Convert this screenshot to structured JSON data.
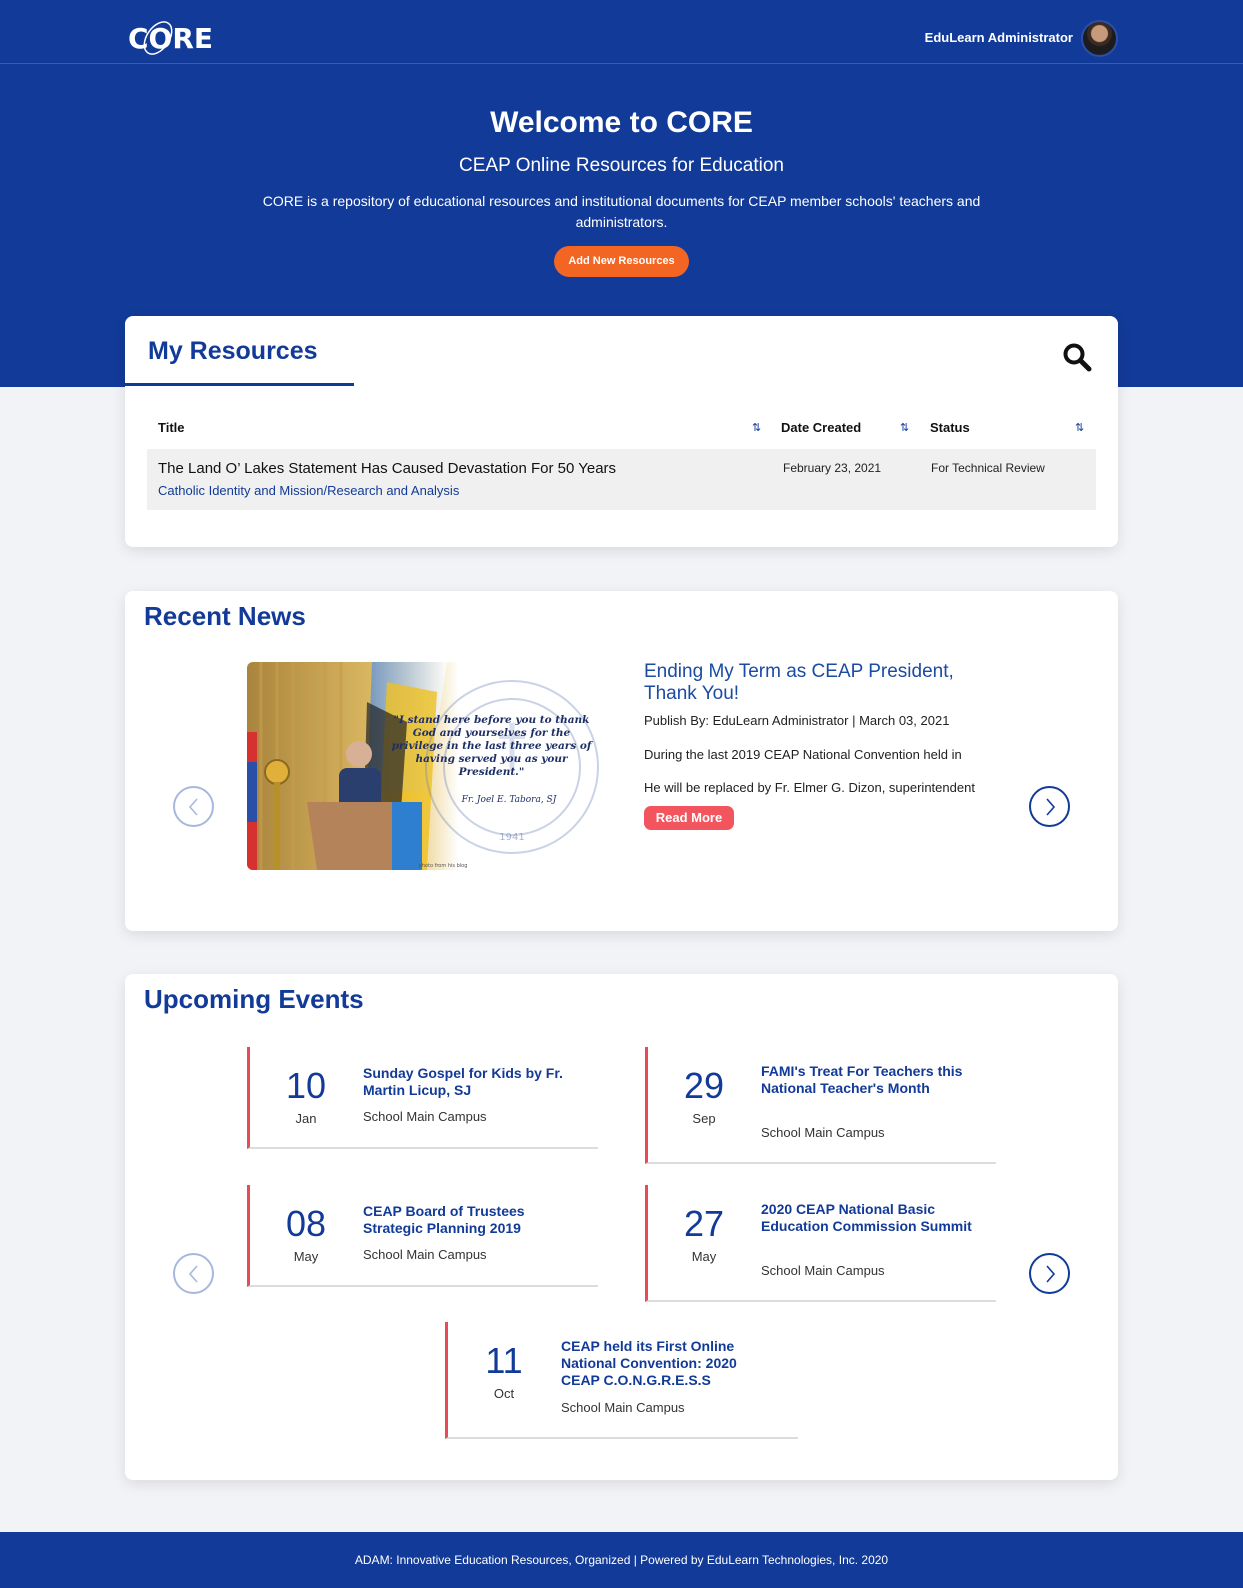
{
  "header": {
    "logo_text": "CORE",
    "user_name": "EduLearn Administrator"
  },
  "hero": {
    "title": "Welcome to CORE",
    "subtitle": "CEAP Online Resources for Education",
    "description": "CORE is a repository of educational resources and institutional documents for CEAP member schools' teachers and administrators.",
    "add_button": "Add New Resources"
  },
  "resources": {
    "title": "My Resources",
    "columns": [
      "Title",
      "Date Created",
      "Status"
    ],
    "rows": [
      {
        "title": "The Land O’ Lakes Statement Has Caused Devastation For 50 Years",
        "category": "Catholic Identity and Mission/Research and Analysis",
        "date": "February 23, 2021",
        "status": "For Technical Review"
      }
    ]
  },
  "news": {
    "section_title": "Recent News",
    "headline": "Ending My Term as CEAP President, Thank You!",
    "meta": "Publish By: EduLearn Administrator | March 03, 2021",
    "para1": "During the last 2019 CEAP National Convention held in",
    "para2": "He will be replaced by Fr. Elmer G. Dizon, superintendent",
    "read_more": "Read More",
    "image_quote": "\"I stand here before you to thank God and yourselves for the privilege in the last three years of having served you as your President.\"",
    "image_signature": "Fr. Joel E. Tabora, SJ",
    "image_seal_text": "CATHOLIC EDUCATIONAL ASSOCIATION OF THE PHILIPPINES",
    "image_seal_year": "1941",
    "image_credit": "photo from his blog"
  },
  "events": {
    "section_title": "Upcoming Events",
    "items": [
      {
        "day": "10",
        "month": "Jan",
        "title": "Sunday Gospel for Kids by Fr. Martin Licup, SJ",
        "location": "School Main Campus"
      },
      {
        "day": "29",
        "month": "Sep",
        "title": "FAMI's Treat For Teachers this National Teacher's Month",
        "location": "School Main Campus"
      },
      {
        "day": "08",
        "month": "May",
        "title": "CEAP Board of Trustees Strategic Planning 2019",
        "location": "School Main Campus"
      },
      {
        "day": "27",
        "month": "May",
        "title": "2020 CEAP National Basic Education Commission Summit",
        "location": "School Main Campus"
      },
      {
        "day": "11",
        "month": "Oct",
        "title": "CEAP held its First Online National Convention: 2020 CEAP C.O.N.G.R.E.S.S",
        "location": "School Main Campus"
      }
    ]
  },
  "footer": {
    "text": "ADAM: Innovative Education Resources, Organized | Powered by EduLearn Technologies, Inc. 2020"
  },
  "colors": {
    "brand_blue": "#123a98",
    "accent_orange": "#f26522",
    "accent_red": "#e84a56"
  }
}
